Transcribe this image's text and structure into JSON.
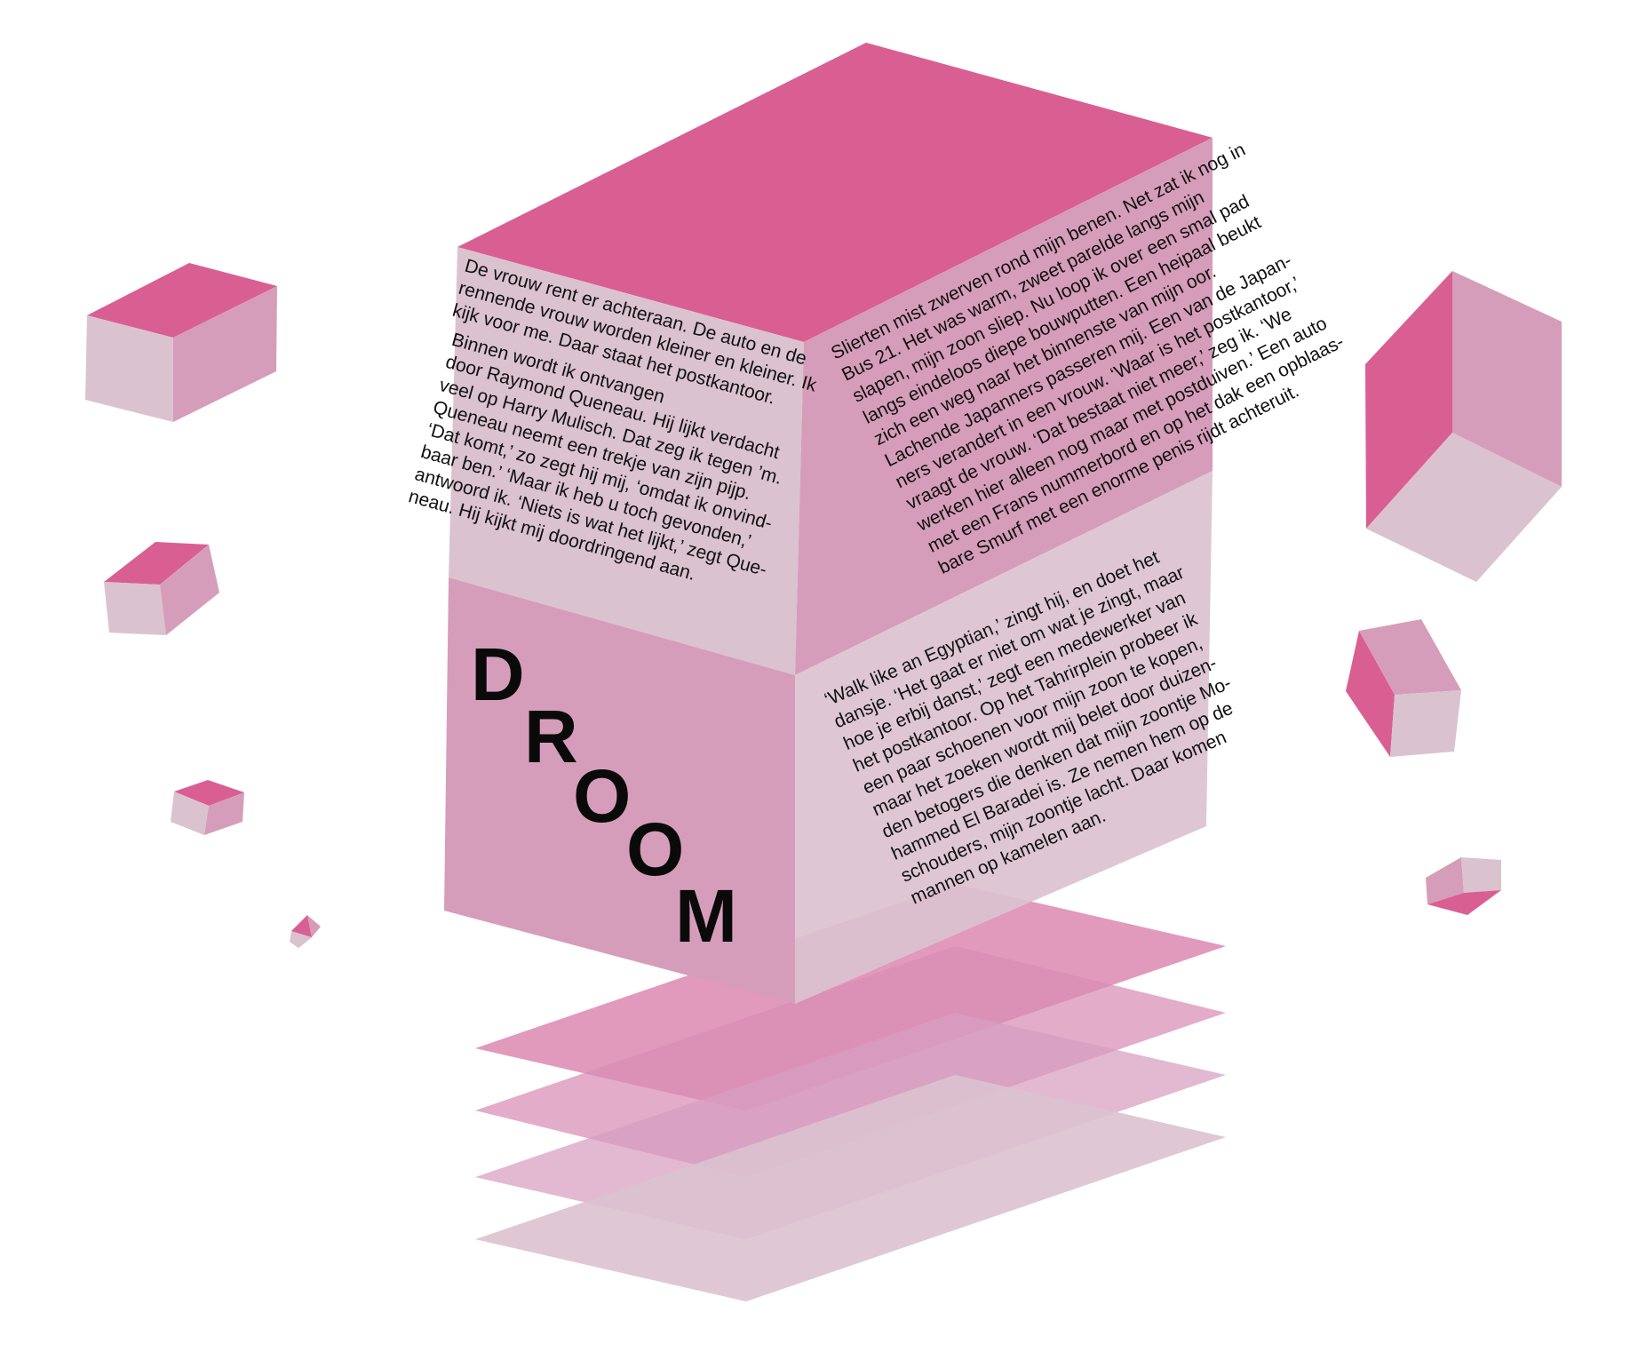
{
  "title": {
    "letters": [
      "D",
      "R",
      "O",
      "O",
      "M"
    ]
  },
  "colors": {
    "hot_pink": "#d95f93",
    "mid_pink": "#d69dba",
    "pale_pink": "#dbc2cf",
    "plate_pink": "#d97fab",
    "text": "#111111"
  },
  "texts": {
    "left_top": [
      "De vrouw rent er achteraan. De auto en de",
      "rennende vrouw worden kleiner en kleiner. Ik",
      "kijk voor me. Daar staat het postkantoor.",
      "Binnen wordt ik ontvangen",
      "door Raymond Queneau. Hij lijkt verdacht",
      "veel op Harry Mulisch. Dat zeg ik tegen ’m.",
      "Queneau neemt een trekje van zijn pijp.",
      "‘Dat komt,’ zo zegt hij mij, ‘omdat ik onvind-",
      "baar ben.’ ‘Maar ik heb u toch gevonden,’",
      "antwoord ik. ‘Niets is wat het lijkt,’ zegt Que-",
      "neau. Hij kijkt mij doordringend aan."
    ],
    "right_top": [
      "Slierten mist zwerven rond mijn benen. Net zat ik nog in",
      "Bus 21. Het was warm, zweet parelde langs mijn",
      "slapen, mijn zoon sliep. Nu loop ik over een smal pad",
      "langs eindeloos diepe bouwputten. Een heipaal beukt",
      "zich een weg naar het binnenste van mijn oor.",
      "Lachende Japanners passeren mij. Een van de Japan-",
      "ners verandert in een vrouw. ‘Waar is het postkantoor,’",
      "vraagt de vrouw. ‘Dat bestaat niet meer,’ zeg ik. ‘We",
      "werken hier alleen nog maar met postduiven.’ Een auto",
      "met een Frans nummerbord en op het dak een opblaas-",
      "bare Smurf met een enorme penis rijdt achteruit."
    ],
    "right_bottom": [
      "‘Walk like an Egyptian,’ zingt hij, en doet het",
      "dansje. ‘Het gaat er niet om wat je zingt, maar",
      "hoe je erbij danst,’ zegt een medewerker van",
      "het postkantoor. Op het Tahrirplein probeer ik",
      "een paar schoenen voor mijn zoon te kopen,",
      "maar het zoeken wordt mij belet door duizen-",
      "den betogers die denken dat mijn zoontje Mo-",
      "hammed El Baradei is. Ze nemen hem op de",
      "schouders, mijn zoontje lacht. Daar komen",
      "mannen op kamelen aan."
    ]
  }
}
